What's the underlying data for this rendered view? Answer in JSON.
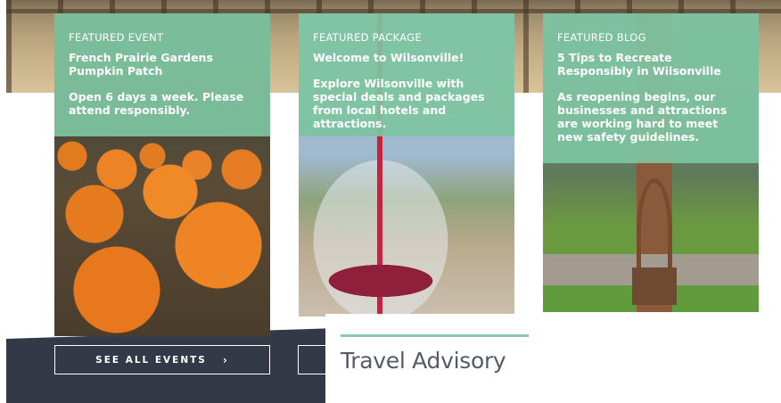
{
  "cards": [
    {
      "kicker": "FEATURED EVENT",
      "title": "French Prairie Gardens Pumpkin Patch",
      "description": "Open 6 days a week. Please attend responsibly."
    },
    {
      "kicker": "FEATURED PACKAGE",
      "title": "Welcome to Wilsonville!",
      "description": "Explore Wilsonville with special deals and packages from local hotels and attractions."
    },
    {
      "kicker": "FEATURED BLOG",
      "title": "5 Tips to Recreate Responsibly in Wilsonville",
      "description": "As reopening begins, our businesses and attractions are working hard to meet new safety guidelines."
    }
  ],
  "buttons": {
    "see_all_events": "SEE ALL EVENTS",
    "chevron": "›"
  },
  "advisory": {
    "heading": "Travel Advisory"
  },
  "colors": {
    "card_overlay": "#7ec4a0",
    "dark_band": "#333947",
    "accent_rule": "#8cc6bb",
    "heading_text": "#545a66"
  }
}
